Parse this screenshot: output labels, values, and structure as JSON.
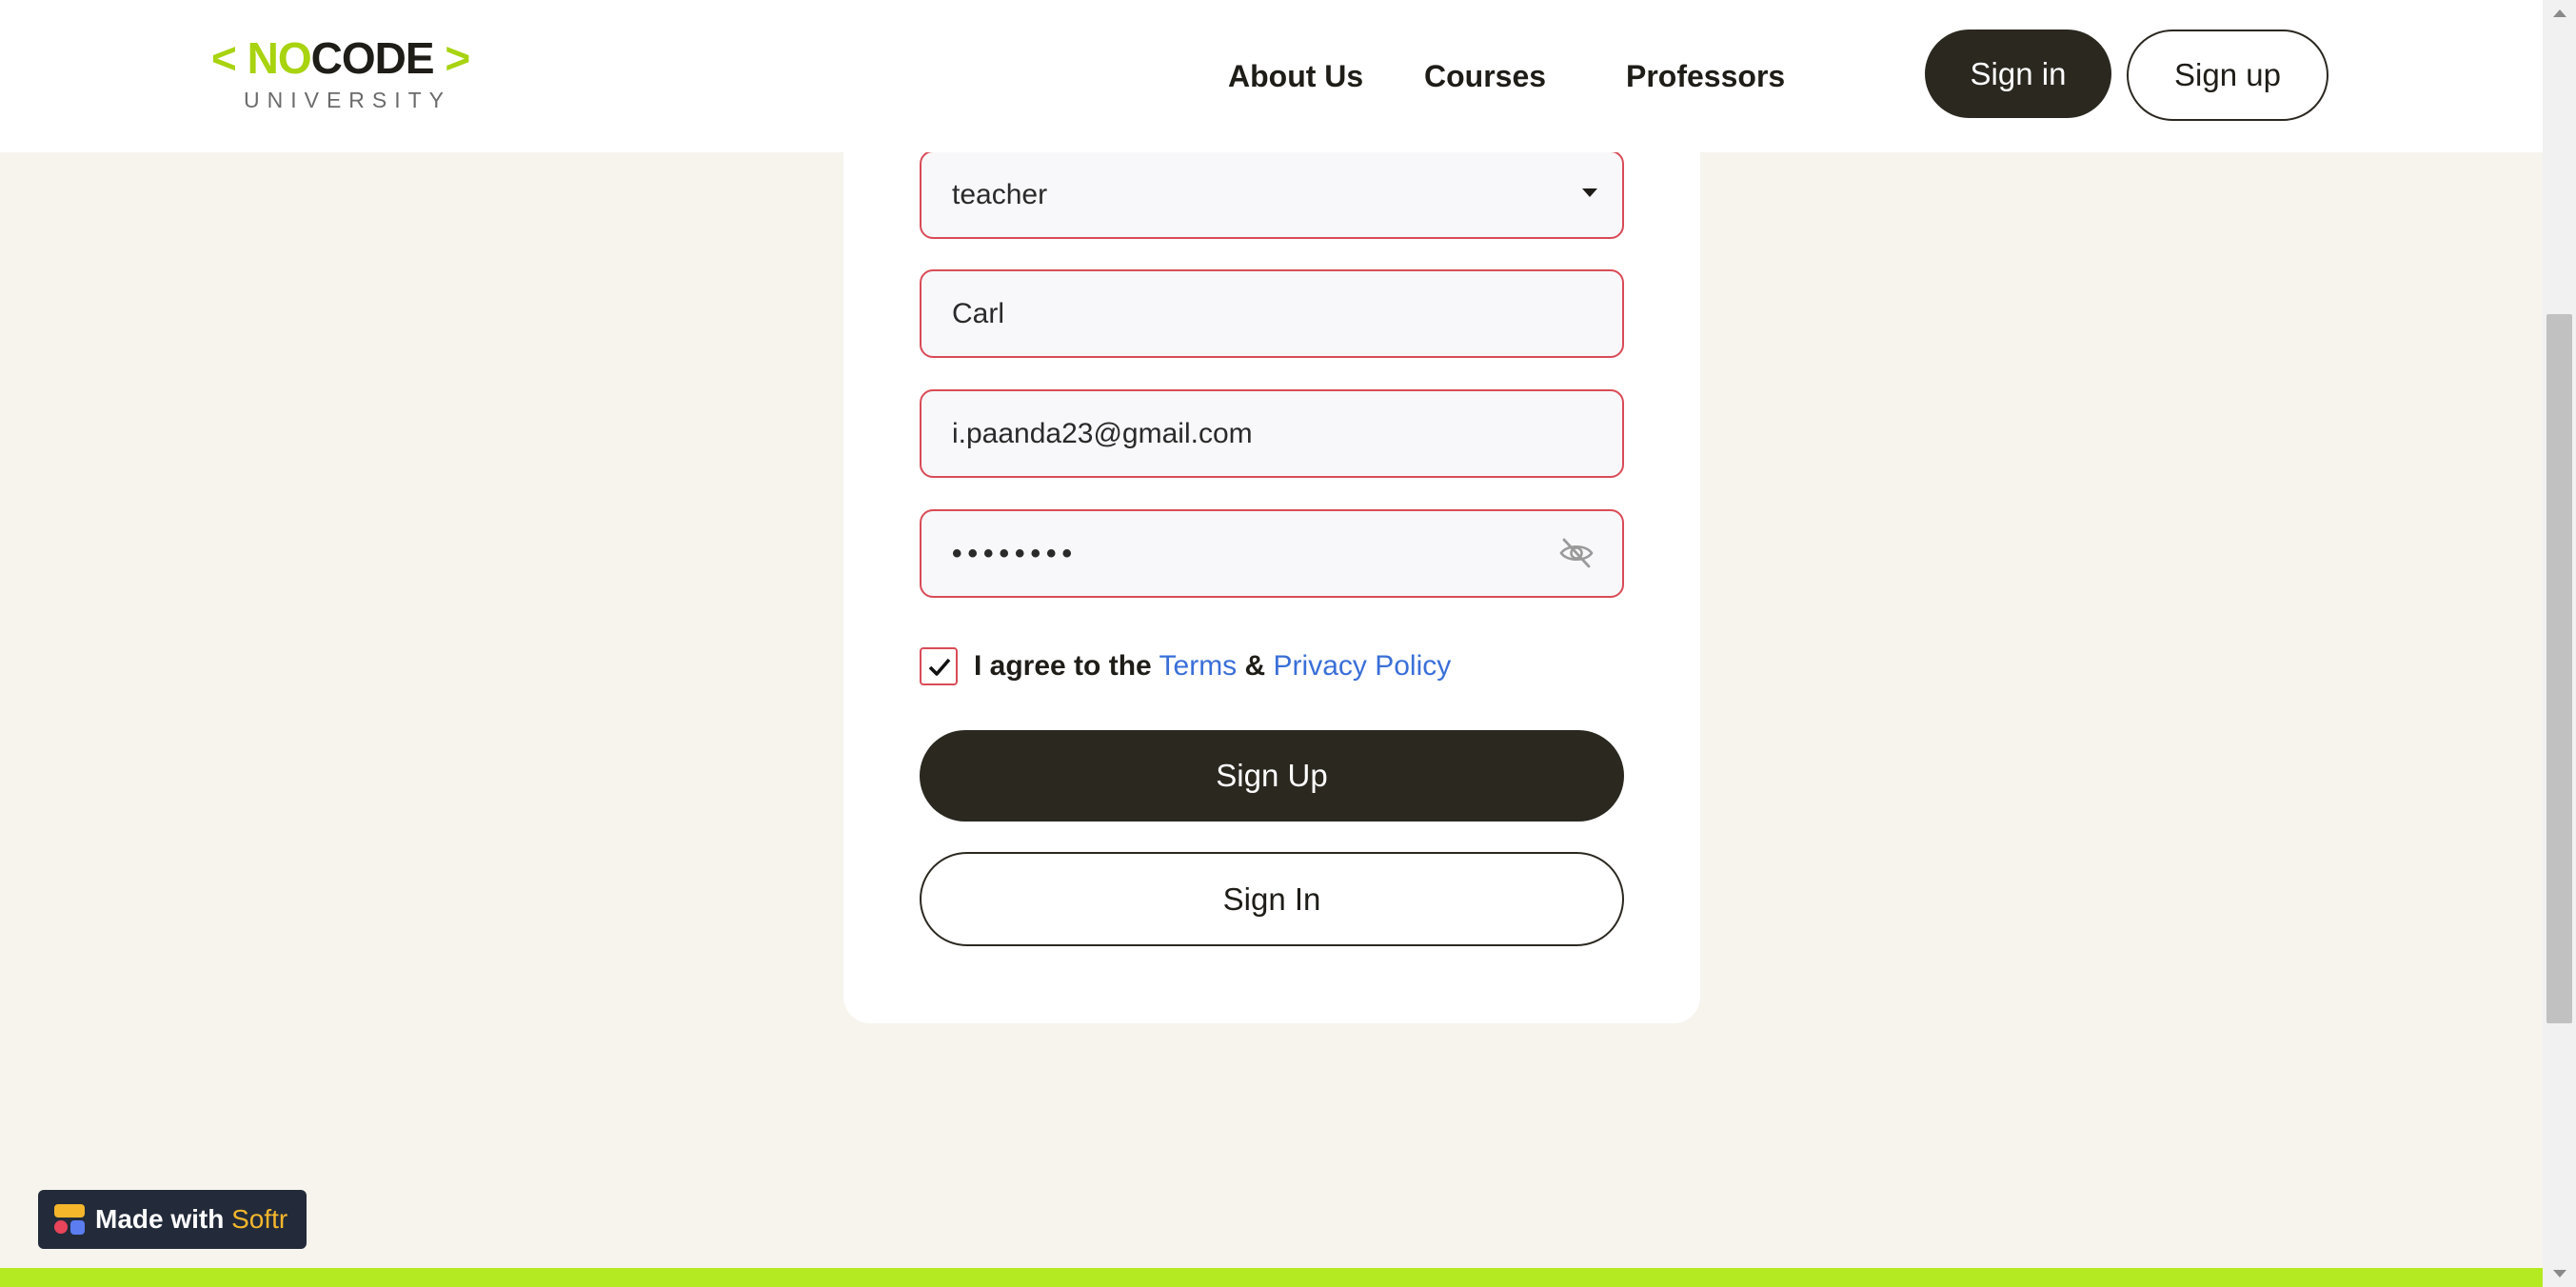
{
  "header": {
    "logo": {
      "left_bracket": "<",
      "no": "NO",
      "code": "CODE",
      "right_bracket": ">",
      "subtitle": "UNIVERSITY"
    },
    "nav": {
      "about": "About Us",
      "courses": "Courses",
      "professors": "Professors"
    },
    "signin_label": "Sign in",
    "signup_label": "Sign up"
  },
  "form": {
    "role_select": {
      "value": "teacher"
    },
    "name_field": {
      "value": "Carl"
    },
    "email_field": {
      "value": "i.paanda23@gmail.com"
    },
    "password_field": {
      "value": "••••••••",
      "toggle_icon": "eye-off-icon"
    },
    "agree": {
      "checked": true,
      "prefix": "I agree to the",
      "terms": "Terms",
      "amp": "&",
      "privacy": "Privacy Policy"
    },
    "signup_button": "Sign Up",
    "signin_button": "Sign In"
  },
  "badge": {
    "prefix": "Made with",
    "brand": "Softr"
  },
  "colors": {
    "accent_green": "#a8d30f",
    "dark": "#2b2820",
    "error_border": "#d94b57",
    "link_blue": "#3a6fd8",
    "page_bg": "#f7f4ee"
  }
}
